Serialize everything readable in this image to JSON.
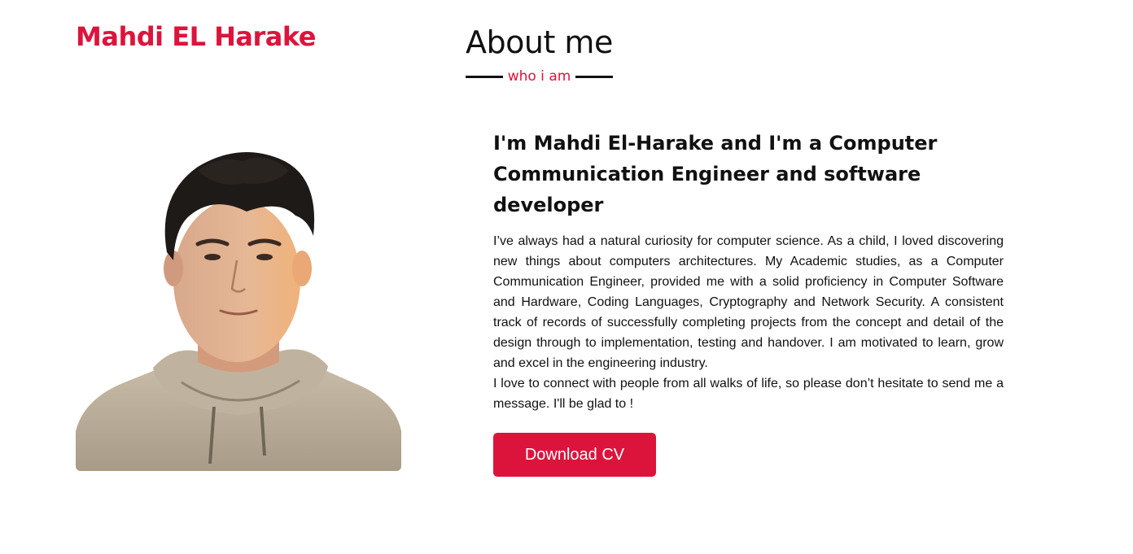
{
  "header": {
    "brand": "Mahdi EL Harake"
  },
  "about": {
    "title": "About me",
    "subtitle": "who i am",
    "headline": "I'm Mahdi El-Harake and I'm a Computer Communication Engineer and software developer",
    "paragraphs": [
      "I’ve always had a natural curiosity for computer science. As a child, I loved discovering new things about computers architectures. My Academic studies, as a Computer Communication Engineer, provided me with a solid proficiency in Computer Software and Hardware, Coding Languages, Cryptography and Network Security. A consistent track of records of successfully completing projects from the concept and detail of the design through to implementation, testing and handover. I am motivated to learn, grow and excel in the engineering industry.",
      "I love to connect with people from all walks of life, so please don’t hesitate to send me a message. I'll be glad to !"
    ],
    "button_label": "Download CV"
  },
  "colors": {
    "accent": "#dc143c",
    "text": "#111111",
    "background": "#ffffff"
  }
}
